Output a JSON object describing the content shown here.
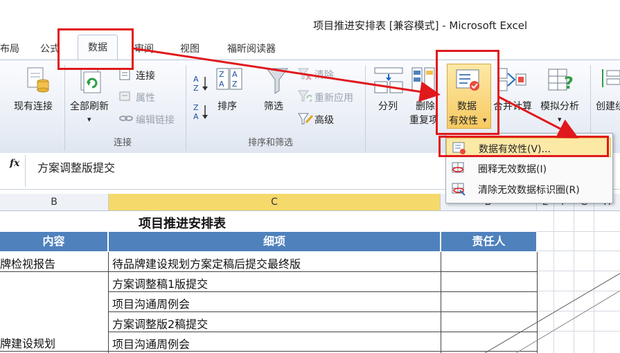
{
  "window": {
    "title": "项目推进安排表 [兼容模式] - Microsoft Excel"
  },
  "tabs": [
    {
      "label": "布局"
    },
    {
      "label": "公式"
    },
    {
      "label": "数据"
    },
    {
      "label": "审阅"
    },
    {
      "label": "视图"
    },
    {
      "label": "福昕阅读器"
    }
  ],
  "ribbon": {
    "connections_group": {
      "label": "连接",
      "existing_connections": "现有连接",
      "refresh_all": "全部刷新",
      "connections": "连接",
      "properties": "属性",
      "edit_links": "编辑链接"
    },
    "sort_filter_group": {
      "label": "排序和筛选",
      "sort": "排序",
      "filter": "筛选",
      "clear": "清除",
      "reapply": "重新应用",
      "advanced": "高级"
    },
    "tools": {
      "text_to_columns": "分列",
      "remove_duplicates_line1": "删除",
      "remove_duplicates_line2": "重复项",
      "data_validation_line1": "数据",
      "data_validation_line2": "有效性",
      "consolidate": "合并计算",
      "what_if": "模拟分析",
      "create_group": "创建组"
    }
  },
  "formula_bar": {
    "fx": "fx",
    "value": "方案调整版提交"
  },
  "columns": [
    "B",
    "C",
    "D",
    "E",
    "F",
    "G",
    "H"
  ],
  "sheet": {
    "title": "项目推进安排表",
    "headers": {
      "content": "内容",
      "detail": "细项",
      "owner": "责任人"
    },
    "rows": [
      {
        "content": "牌检视报告",
        "detail": "待品牌建设规划方案定稿后提交最终版"
      },
      {
        "content": "",
        "detail": "方案调整稿1版提交"
      },
      {
        "content": "",
        "detail": "项目沟通周例会"
      },
      {
        "content": "",
        "detail": "方案调整版2稿提交"
      },
      {
        "content": "牌建设规划",
        "detail": "项目沟通周例会"
      }
    ]
  },
  "dropdown": {
    "items": [
      {
        "label": "数据有效性(V)...",
        "icon": "data-validation-icon"
      },
      {
        "label": "圈释无效数据(I)",
        "icon": "circle-invalid-icon"
      },
      {
        "label": "清除无效数据标识圈(R)",
        "icon": "clear-circles-icon"
      }
    ]
  },
  "colors": {
    "header_blue": "#4f81bd",
    "highlight_red": "#e0191c",
    "selected_col": "#f6d96b"
  }
}
